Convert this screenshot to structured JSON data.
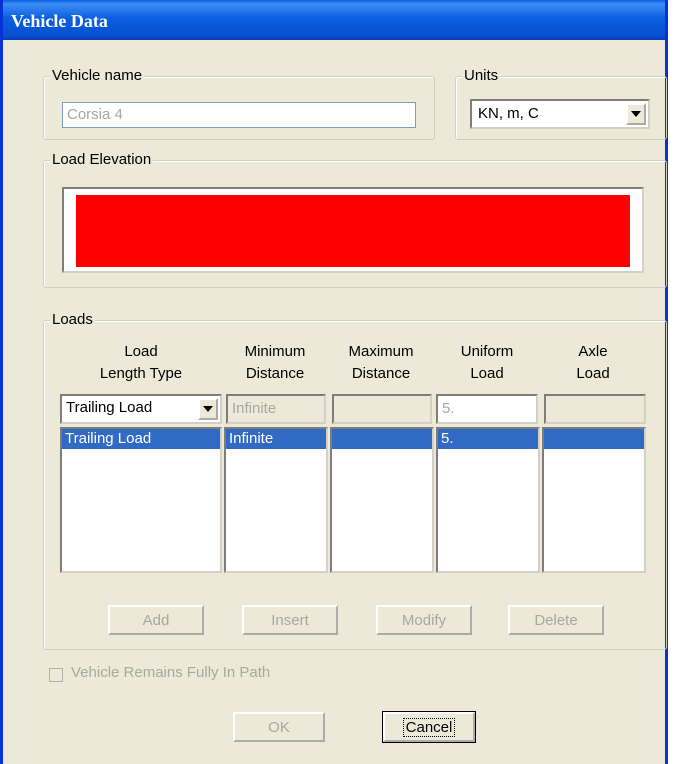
{
  "window": {
    "title": "Vehicle Data"
  },
  "vehicle_name": {
    "label": "Vehicle name",
    "value": "Corsia 4"
  },
  "units": {
    "label": "Units",
    "selected": "KN, m, C"
  },
  "load_elevation": {
    "label": "Load Elevation",
    "bar_color": "#ff0000"
  },
  "loads": {
    "label": "Loads",
    "columns": [
      {
        "line1": "Load",
        "line2": "Length Type"
      },
      {
        "line1": "Minimum",
        "line2": "Distance"
      },
      {
        "line1": "Maximum",
        "line2": "Distance"
      },
      {
        "line1": "Uniform",
        "line2": "Load"
      },
      {
        "line1": "Axle",
        "line2": "Load"
      }
    ],
    "edit_row": {
      "load_type": "Trailing Load",
      "min_distance": "Infinite",
      "max_distance": "",
      "uniform_load": "5.",
      "axle_load": ""
    },
    "rows": [
      {
        "load_type": "Trailing Load",
        "min_distance": "Infinite",
        "max_distance": "",
        "uniform_load": "5.",
        "axle_load": ""
      }
    ],
    "buttons": {
      "add": "Add",
      "insert": "Insert",
      "modify": "Modify",
      "delete": "Delete"
    }
  },
  "checkbox": {
    "label": "Vehicle Remains Fully In Path",
    "checked": false
  },
  "footer": {
    "ok": "OK",
    "cancel": "Cancel"
  }
}
